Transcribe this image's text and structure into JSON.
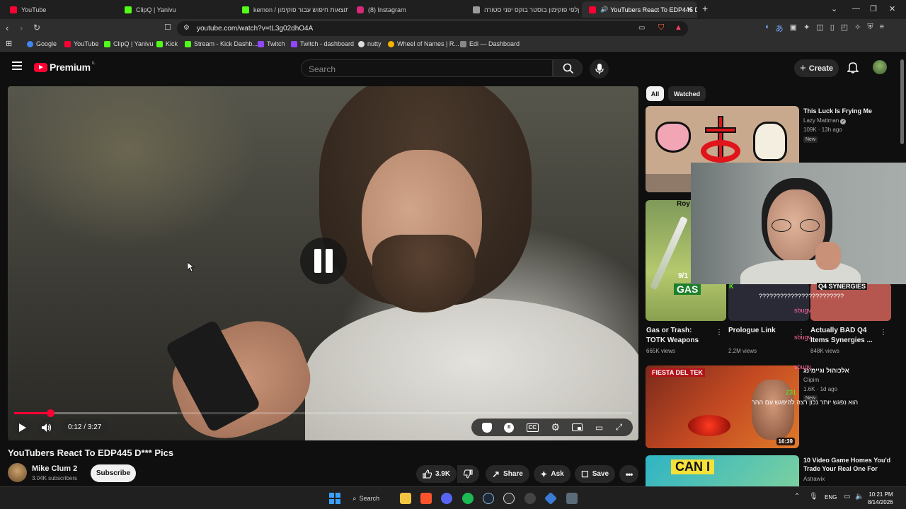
{
  "browser": {
    "tabs": [
      {
        "label": "YouTube",
        "color": "#ff0033",
        "active": false
      },
      {
        "label": "ClipQ | Yanivu",
        "color": "#53fc18",
        "active": false
      },
      {
        "label": "‎kemon / תוצאות חיפוש עבור פוקימון",
        "color": "#53fc18",
        "active": false
      },
      {
        "label": "(8) Instagram",
        "color": "#d62976",
        "active": false
      },
      {
        "label": "קלפי פוקימון בוסטר בוקס יפני סטורה",
        "color": "#9b9b9b",
        "active": false
      },
      {
        "label": "YouTubers React To EDP445 D",
        "color": "#ff0033",
        "active": true
      }
    ],
    "url": "youtube.com/watch?v=tL3g02dhO4A",
    "bookmarks": [
      {
        "label": "Google",
        "color": "#4285f4"
      },
      {
        "label": "YouTube",
        "color": "#ff0033"
      },
      {
        "label": "ClipQ | Yanivu",
        "color": "#53fc18"
      },
      {
        "label": "Kick",
        "color": "#53fc18"
      },
      {
        "label": "Stream - Kick Dashb...",
        "color": "#53fc18"
      },
      {
        "label": "Twitch",
        "color": "#9146ff"
      },
      {
        "label": "Twitch - dashboard",
        "color": "#9146ff"
      },
      {
        "label": "nutty",
        "color": "#dddddd"
      },
      {
        "label": "Wheel of Names | R...",
        "color": "#f4b400"
      },
      {
        "label": "Edi — Dashboard",
        "color": "#888888"
      }
    ]
  },
  "header": {
    "logo_text": "Premium",
    "logo_region": "IL",
    "search_placeholder": "Search",
    "create_label": "Create"
  },
  "player": {
    "current_time": "0:12",
    "duration": "3:27",
    "time_display": "0:12 / 3:27",
    "progress_fraction": 0.058
  },
  "video": {
    "title": "YouTubers React To EDP445 D*** Pics",
    "channel": "Mike Clum 2",
    "subscribers": "3.04K subscribers",
    "subscribe_label": "Subscribe",
    "likes": "3.9K",
    "share_label": "Share",
    "ask_label": "Ask",
    "save_label": "Save"
  },
  "sidebar": {
    "chips": [
      "All",
      "Watched"
    ],
    "recs": [
      {
        "title": "This Luck Is Frying Me",
        "channel": "Lazy Mattman",
        "meta": "109K · 13h ago",
        "badge": "New"
      },
      {
        "title": "אלכוהול וגיימינג",
        "channel": "Clipim",
        "meta": "1.6K · 1d ago",
        "badge": "New"
      },
      {
        "title": "10 Video Game Homes You'd Trade Your Real One For",
        "channel": "Astrawix",
        "meta": ""
      }
    ],
    "shorts": [
      {
        "title": "Gas or Trash: TOTK Weapons",
        "views": "665K views",
        "overlay_text": "GAS"
      },
      {
        "title": "Prologue Link",
        "views": "2.2M views"
      },
      {
        "title": "Actually BAD Q4 Items Synergies ...",
        "views": "848K views"
      }
    ],
    "tekken_duration": "16:39",
    "tekken_banner": "FIESTA DEL TEK",
    "caniv_text": "CAN I",
    "partial_label": "Roy",
    "partial_count": "9/1"
  },
  "overlay": {
    "chat_question": "????????????????????????",
    "chat_user": "sbugv",
    "synergies_text": "Q4 SYNERGIES",
    "hebrew_caption": "הוא נפגש יותר נכון רצה להיפגש עם ההר",
    "chat_num": "231"
  },
  "taskbar": {
    "search_label": "Search",
    "lang": "ENG",
    "time": "10:21 PM",
    "date": "8/14/2026"
  }
}
